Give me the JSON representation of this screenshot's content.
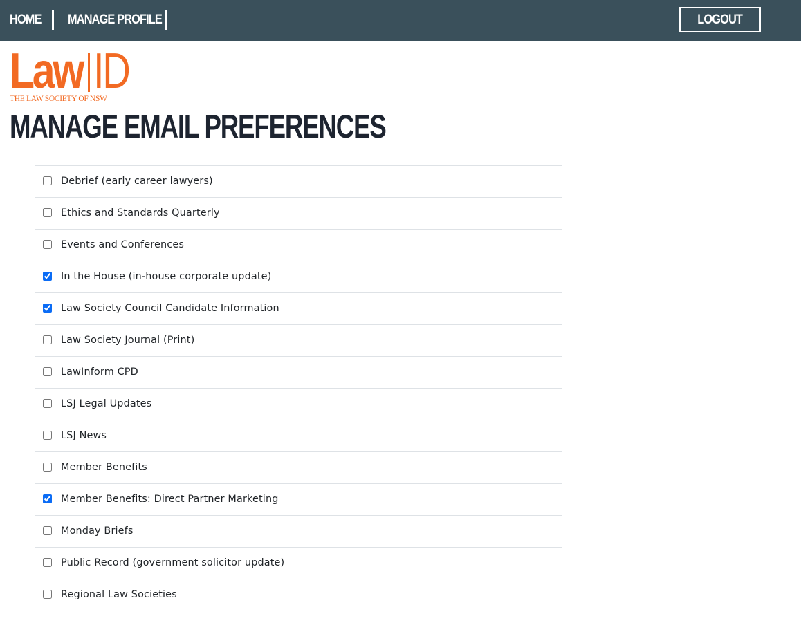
{
  "nav": {
    "home_label": "HOME",
    "profile_label": "MANAGE PROFILE",
    "logout_label": "LOGOUT"
  },
  "logo": {
    "main": "Law",
    "id": "ID",
    "subtitle": "THE LAW SOCIETY OF NSW"
  },
  "page": {
    "title": "MANAGE EMAIL PREFERENCES"
  },
  "colors": {
    "topbar": "#3a505b",
    "brand_orange": "#f26a23",
    "checkbox_checked": "#0b6cf5"
  },
  "preferences": [
    {
      "label": "Debrief (early career lawyers)",
      "checked": false
    },
    {
      "label": "Ethics and Standards Quarterly",
      "checked": false
    },
    {
      "label": "Events and Conferences",
      "checked": false
    },
    {
      "label": "In the House (in-house corporate update)",
      "checked": true
    },
    {
      "label": "Law Society Council Candidate Information",
      "checked": true
    },
    {
      "label": "Law Society Journal (Print)",
      "checked": false
    },
    {
      "label": "LawInform CPD",
      "checked": false
    },
    {
      "label": "LSJ Legal Updates",
      "checked": false
    },
    {
      "label": "LSJ News",
      "checked": false
    },
    {
      "label": "Member Benefits",
      "checked": false
    },
    {
      "label": "Member Benefits: Direct Partner Marketing",
      "checked": true
    },
    {
      "label": "Monday Briefs",
      "checked": false
    },
    {
      "label": "Public Record (government solicitor update)",
      "checked": false
    },
    {
      "label": "Regional Law Societies",
      "checked": false
    }
  ]
}
